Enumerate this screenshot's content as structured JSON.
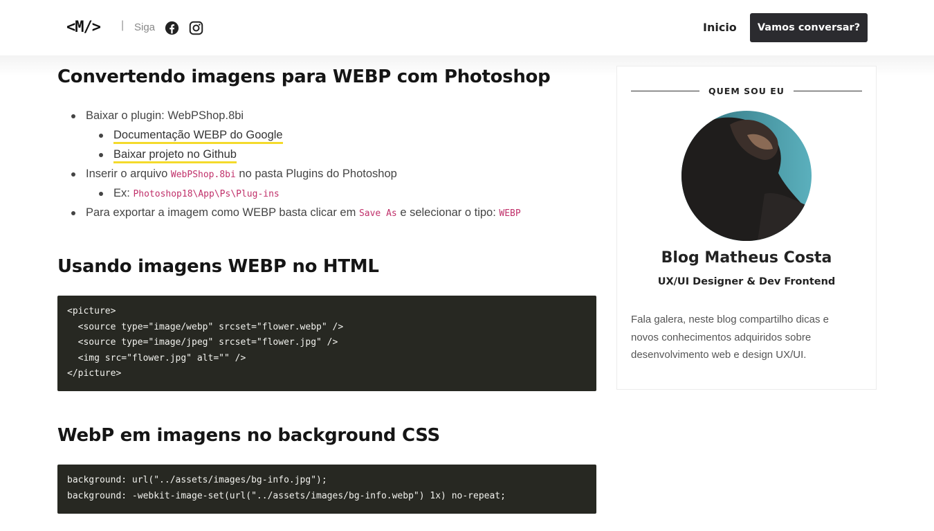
{
  "header": {
    "logo": "<M/>",
    "separator": "|",
    "follow_label": "Siga",
    "nav_home": "Inicio",
    "cta_label": "Vamos conversar?",
    "social_icons": [
      "facebook-icon",
      "instagram-icon"
    ]
  },
  "article": {
    "section1_title": "Convertendo imagens para WEBP com Photoshop",
    "list": {
      "item1_text": "Baixar o plugin: WebPShop.8bi",
      "item1_link1": "Documentação WEBP do Google",
      "item1_link2": "Baixar projeto no Github",
      "item2_prefix": "Inserir o arquivo ",
      "item2_code": "WebPShop.8bi",
      "item2_suffix": " no pasta Plugins do Photoshop",
      "item2_sub_prefix": "Ex: ",
      "item2_sub_code": "Photoshop18\\App\\Ps\\Plug-ins",
      "item3_prefix": "Para exportar a imagem como WEBP basta clicar em ",
      "item3_code1": "Save As",
      "item3_middle": " e selecionar o tipo: ",
      "item3_code2": "WEBP"
    },
    "section2_title": "Usando imagens WEBP no HTML",
    "code1": "<picture>\n  <source type=\"image/webp\" srcset=\"flower.webp\" />\n  <source type=\"image/jpeg\" srcset=\"flower.jpg\" />\n  <img src=\"flower.jpg\" alt=\"\" />\n</picture>",
    "section3_title": "WebP em imagens no background CSS",
    "code2": "background: url(\"../assets/images/bg-info.jpg\");\nbackground: -webkit-image-set(url(\"../assets/images/bg-info.webp\") 1x) no-repeat;"
  },
  "sidebar": {
    "title": "QUEM SOU EU",
    "name": "Blog Matheus Costa",
    "role": "UX/UI Designer & Dev Frontend",
    "description": "Fala galera, neste blog compartilho dicas e novos conhecimentos adquiridos sobre desenvolvimento web e design UX/UI."
  },
  "colors": {
    "accent_underline": "#f4da2b",
    "code_bg": "#272822",
    "inline_code": "#c0306a",
    "cta_bg": "#2b2b2f"
  }
}
